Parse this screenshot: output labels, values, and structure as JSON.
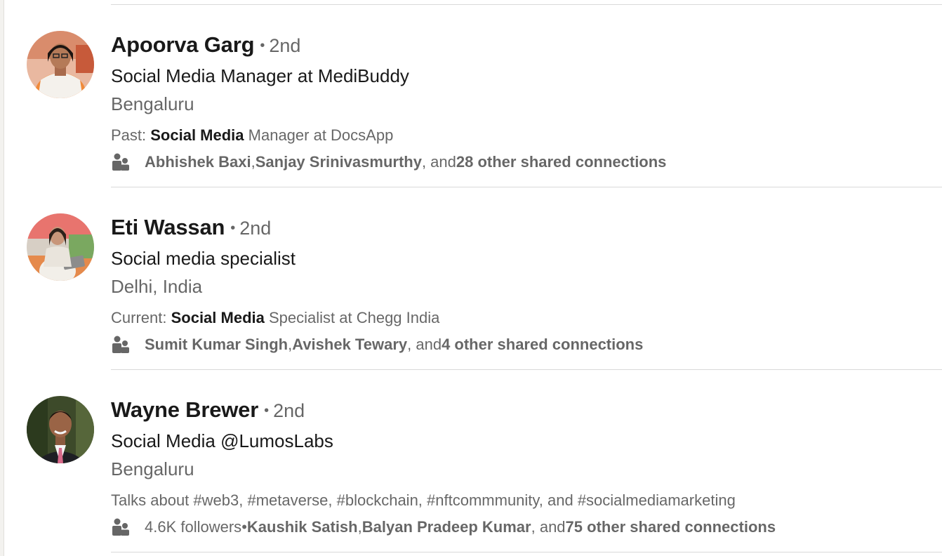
{
  "colors": {
    "text_primary": "#191919",
    "text_secondary": "#666666",
    "divider": "#d9d9d9",
    "background": "#ffffff"
  },
  "results": [
    {
      "name": "Apoorva Garg",
      "separator": "•",
      "degree": "2nd",
      "headline": "Social Media Manager at MediBuddy",
      "location": "Bengaluru",
      "summary_prefix": "Past: ",
      "summary_bold": "Social Media",
      "summary_suffix": " Manager at DocsApp",
      "followers": "",
      "followers_separator": "",
      "connection_1": "Abhishek Baxi",
      "sep_1": ", ",
      "connection_2": "Sanjay Srinivasmurthy",
      "sep_2": ", and ",
      "others": "28 other shared connections",
      "avatar_icon": "person-photo-orange-top"
    },
    {
      "name": "Eti Wassan",
      "separator": "•",
      "degree": "2nd",
      "headline": "Social media specialist",
      "location": "Delhi, India",
      "summary_prefix": "Current: ",
      "summary_bold": "Social Media",
      "summary_suffix": " Specialist at Chegg India",
      "followers": "",
      "followers_separator": "",
      "connection_1": "Sumit Kumar Singh",
      "sep_1": ", ",
      "connection_2": "Avishek Tewary",
      "sep_2": ", and ",
      "others": "4 other shared connections",
      "avatar_icon": "person-photo-laptop"
    },
    {
      "name": "Wayne Brewer",
      "separator": "•",
      "degree": "2nd",
      "headline": "Social Media @LumosLabs",
      "location": "Bengaluru",
      "summary_prefix": "Talks about #web3, #metaverse, #blockchain, #nftcommmunity, and #socialmediamarketing",
      "summary_bold": "",
      "summary_suffix": "",
      "followers": "4.6K followers",
      "followers_separator": " • ",
      "connection_1": "Kaushik Satish",
      "sep_1": ", ",
      "connection_2": "Balyan Pradeep Kumar",
      "sep_2": ", and ",
      "others": "75 other shared connections",
      "avatar_icon": "person-photo-suit"
    }
  ]
}
